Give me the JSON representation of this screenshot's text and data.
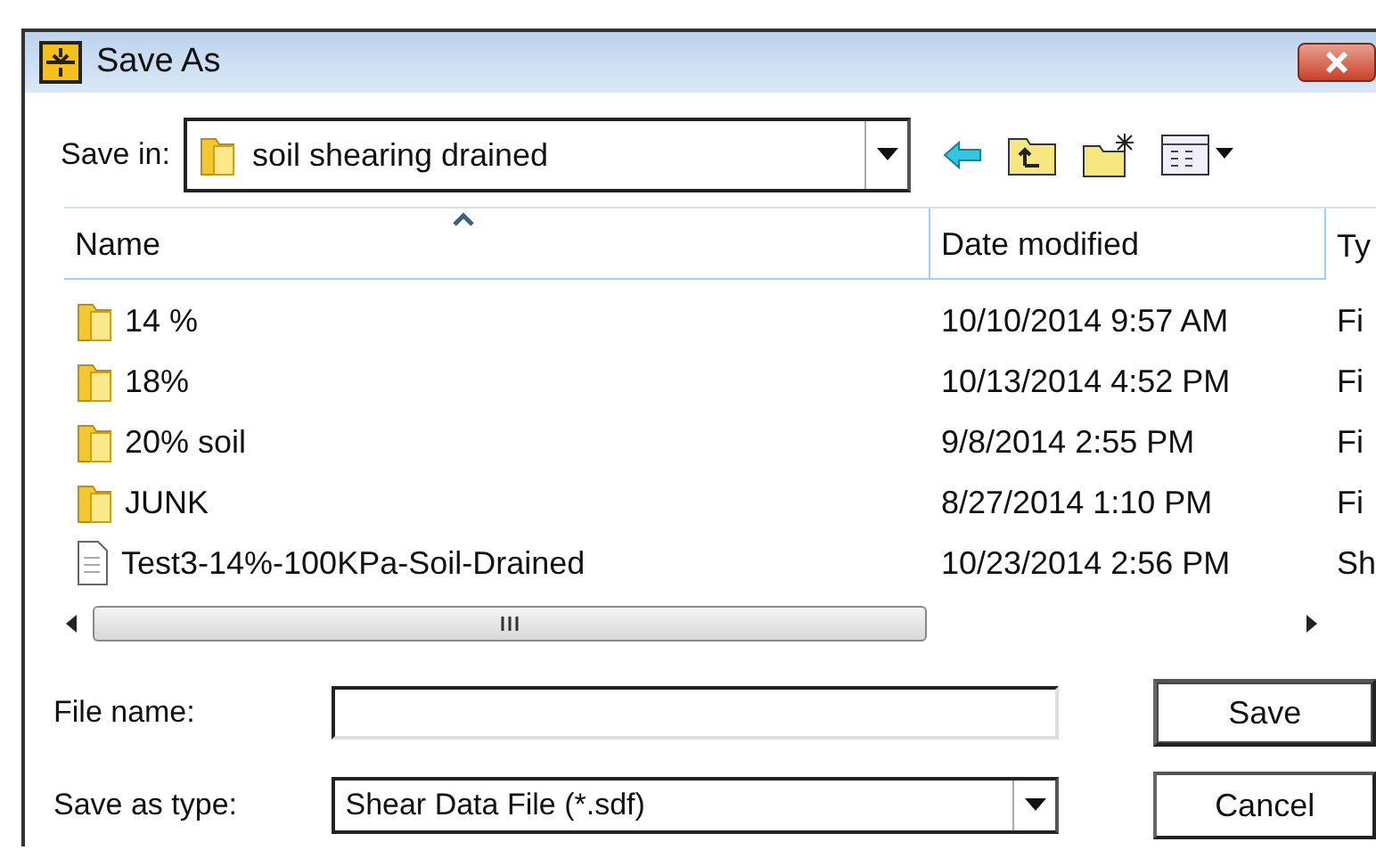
{
  "window": {
    "title": "Save As"
  },
  "save_in": {
    "label": "Save in:",
    "value": "soil shearing drained"
  },
  "columns": [
    {
      "label": "Name",
      "sorted": true
    },
    {
      "label": "Date modified",
      "sorted": false
    },
    {
      "label": "Ty",
      "sorted": false
    }
  ],
  "rows": [
    {
      "kind": "folder",
      "name": "14 %",
      "date": "10/10/2014 9:57 AM",
      "column_3": "Fi"
    },
    {
      "kind": "folder",
      "name": "18%",
      "date": "10/13/2014 4:52 PM",
      "column_3": "Fi"
    },
    {
      "kind": "folder",
      "name": "20% soil",
      "date": "9/8/2014 2:55 PM",
      "column_3": "Fi"
    },
    {
      "kind": "folder",
      "name": "JUNK",
      "date": "8/27/2014 1:10 PM",
      "column_3": "Fi"
    },
    {
      "kind": "file",
      "name": "Test3-14%-100KPa-Soil-Drained",
      "date": "10/23/2014 2:56 PM",
      "column_3": "Sh"
    }
  ],
  "file_name": {
    "label": "File name:"
  },
  "save_as_type": {
    "label": "Save as type:",
    "value": "Shear Data File (*.sdf)"
  },
  "buttons": [
    {
      "label": "Save",
      "default": true
    },
    {
      "label": "Cancel",
      "default": false
    }
  ]
}
